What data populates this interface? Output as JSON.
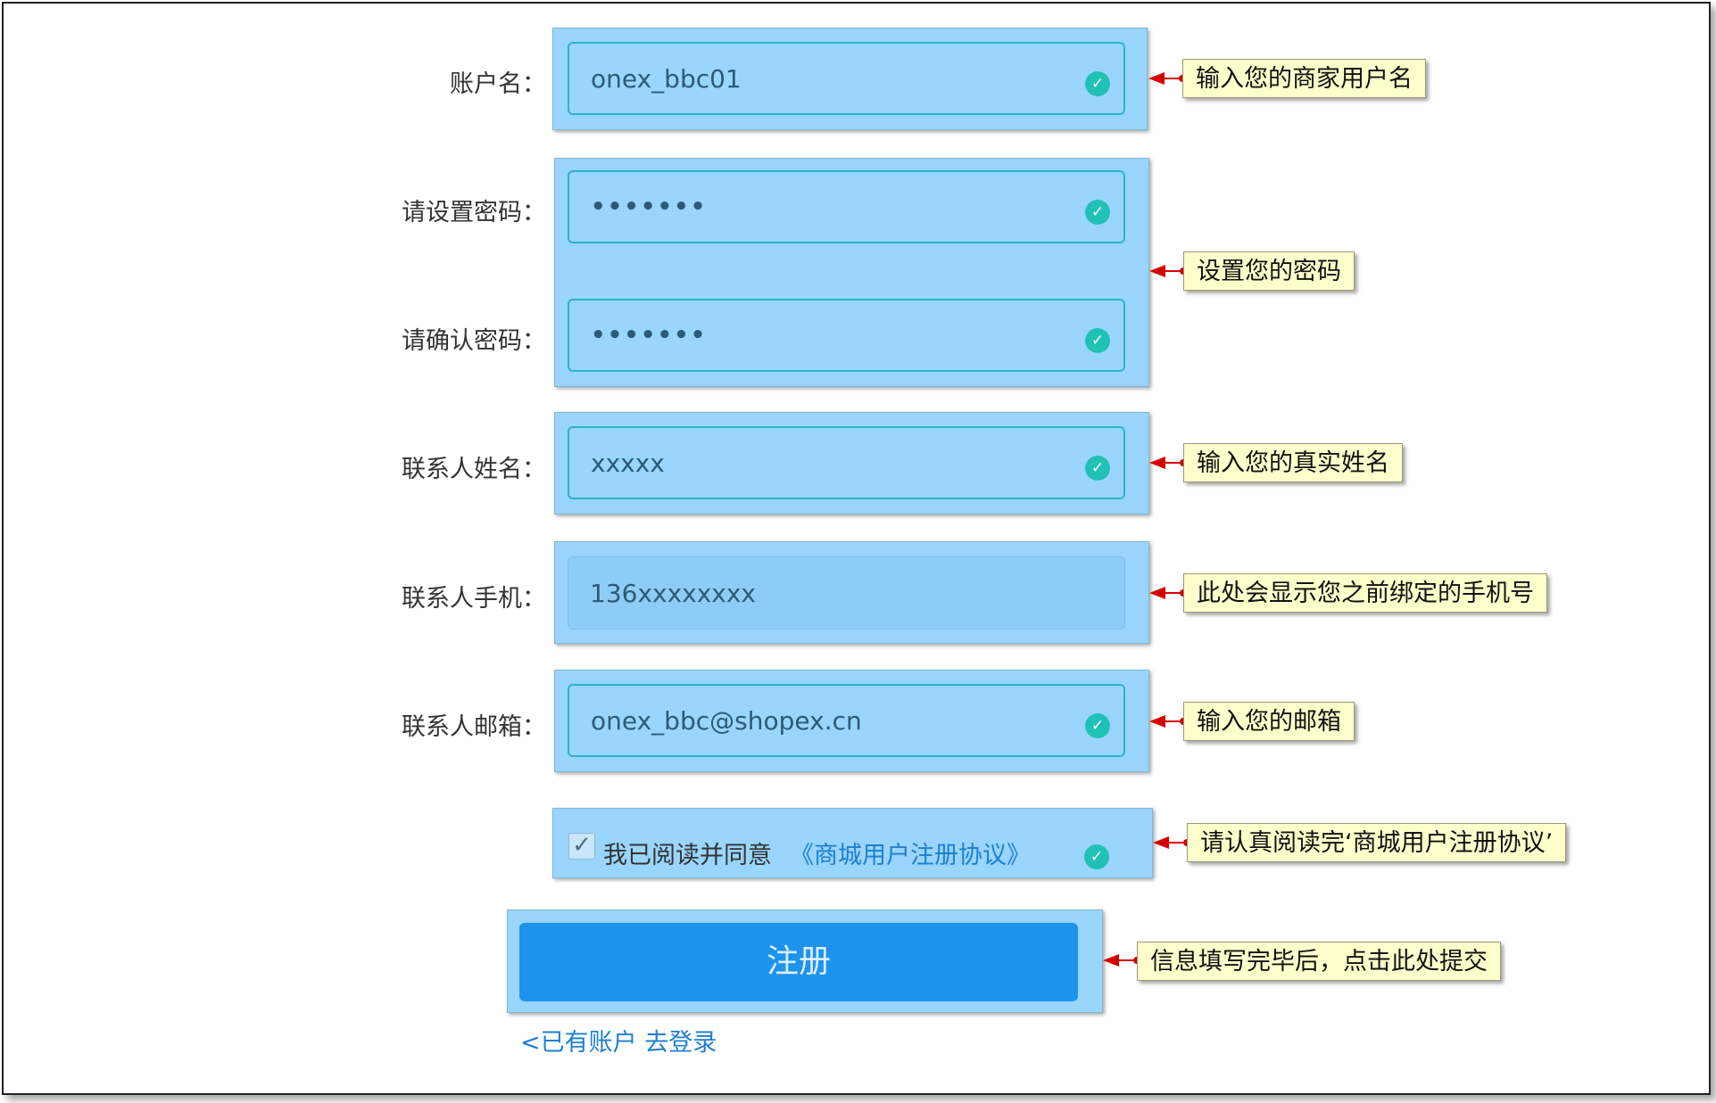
{
  "fields": [
    {
      "label": "账户名：",
      "value": "onex_bbc01",
      "valid": true
    },
    {
      "label": "请设置密码：",
      "value": "•••••••",
      "valid": true
    },
    {
      "label": "请确认密码：",
      "value": "•••••••",
      "valid": true
    },
    {
      "label": "联系人姓名：",
      "value": "xxxxx",
      "valid": true
    },
    {
      "label": "联系人手机：",
      "value": "136xxxxxxxx",
      "valid": false,
      "disabled": true
    },
    {
      "label": "联系人邮箱：",
      "value": "onex_bbc@shopex.cn",
      "valid": true
    }
  ],
  "agreement": {
    "checked": true,
    "check_mark": "✓",
    "text": "我已阅读并同意",
    "link": "《商城用户注册协议》",
    "valid": true
  },
  "submit_label": "注册",
  "login_link": "<已有账户 去登录",
  "valid_icon": "check-circle-icon",
  "valid_mark": "✓",
  "callouts": {
    "username": "输入您的商家用户名",
    "password": "设置您的密码",
    "name": "输入您的真实姓名",
    "phone": "此处会显示您之前绑定的手机号",
    "email": "输入您的邮箱",
    "agreement": "请认真阅读完‘商城用户注册协议’",
    "submit": "信息填写完毕后，点击此处提交"
  },
  "colors": {
    "highlight": "#99d5fd",
    "field_border": "#2bb6c5",
    "valid_badge": "#21c1b6",
    "button": "#1e93ee",
    "link": "#1f7fd1",
    "callout_bg": "#ffffcc",
    "arrow": "#d40000"
  }
}
